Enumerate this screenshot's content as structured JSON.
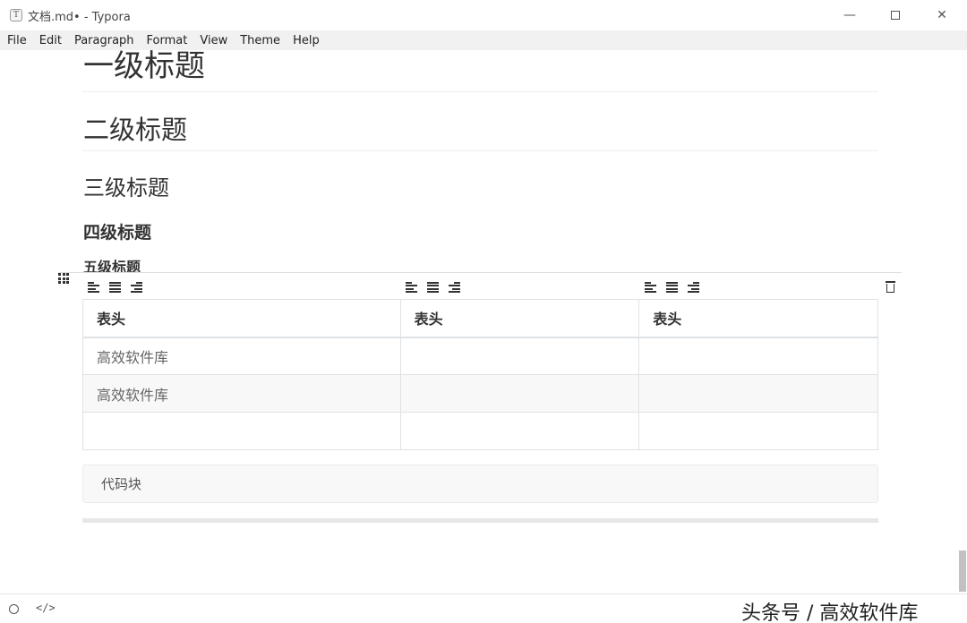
{
  "window": {
    "title": "文档.md• - Typora",
    "app_icon_letter": "T",
    "minimize_glyph": "—",
    "close_glyph": "✕"
  },
  "menu": [
    "File",
    "Edit",
    "Paragraph",
    "Format",
    "View",
    "Theme",
    "Help"
  ],
  "document": {
    "h1": "一级标题",
    "h2": "二级标题",
    "h3": "三级标题",
    "h4": "四级标题",
    "h5": "五级标题"
  },
  "table": {
    "headers": [
      "表头",
      "表头",
      "表头"
    ],
    "rows": [
      [
        "高效软件库",
        "",
        ""
      ],
      [
        "高效软件库",
        "",
        ""
      ],
      [
        "",
        "",
        ""
      ]
    ]
  },
  "code_block": "代码块",
  "statusbar": {
    "source_toggle": "</>",
    "watermark": "头条号 / 高效软件库"
  }
}
